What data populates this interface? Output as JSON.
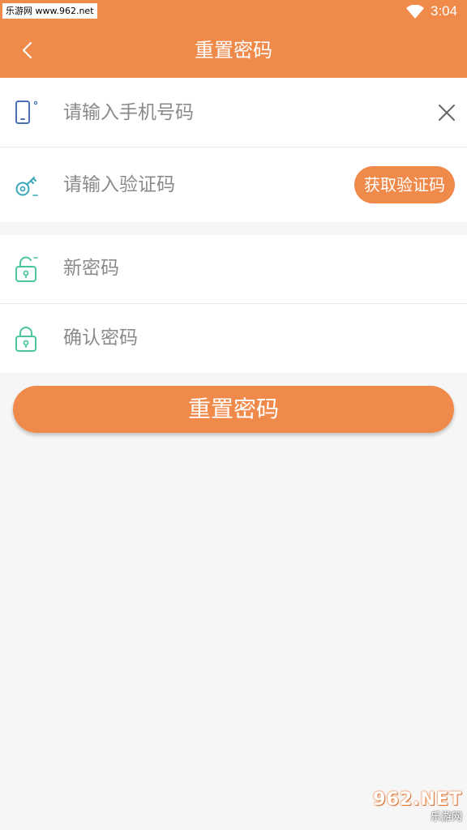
{
  "status_bar": {
    "watermark": "乐游网 www.962.net",
    "time": "3:04",
    "wifi_icon": "wifi-icon"
  },
  "app_bar": {
    "title": "重置密码",
    "back_icon": "chevron-left-icon",
    "background": "#f08a4b"
  },
  "form": {
    "phone": {
      "placeholder": "请输入手机号码",
      "icon": "phone-icon",
      "clear_icon": "close-icon"
    },
    "code": {
      "placeholder": "请输入验证码",
      "icon": "key-icon",
      "button_label": "获取验证码"
    },
    "new_password": {
      "placeholder": "新密码",
      "icon": "lock-icon"
    },
    "confirm_password": {
      "placeholder": "确认密码",
      "icon": "lock-icon"
    }
  },
  "submit_label": "重置密码",
  "watermark_br": {
    "logo": "962.NET",
    "sub": "乐游网"
  },
  "colors": {
    "accent": "#f08a4b",
    "icon_blue": "#4a6fb5",
    "icon_teal": "#3aa6b9",
    "icon_green": "#4cc59a"
  }
}
